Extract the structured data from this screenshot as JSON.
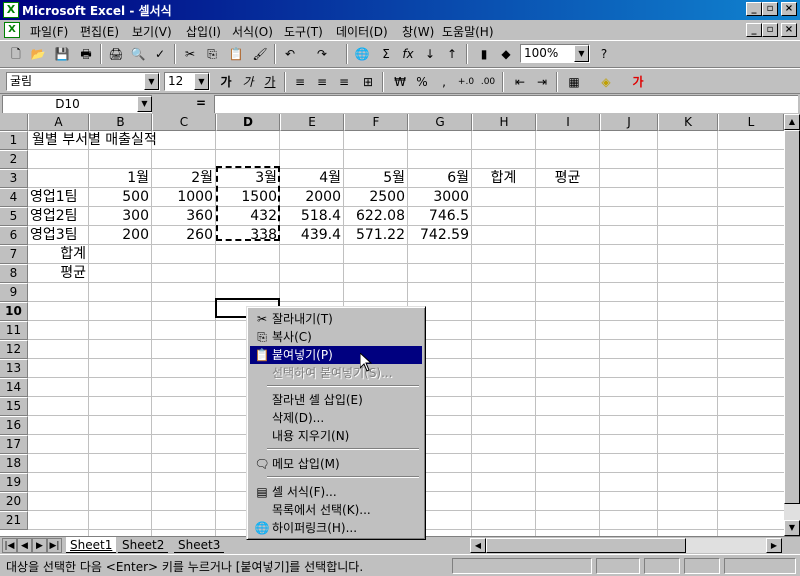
{
  "window": {
    "title": "Microsoft Excel - 셀서식"
  },
  "menu": [
    "파일(F)",
    "편집(E)",
    "보기(V)",
    "삽입(I)",
    "서식(O)",
    "도구(T)",
    "데이터(D)",
    "창(W)",
    "도움말(H)"
  ],
  "toolbar": {
    "zoom": "100%"
  },
  "format_toolbar": {
    "font_name": "굴림",
    "font_size": "12"
  },
  "namebox": {
    "value": "D10"
  },
  "formula": {
    "equals": "=",
    "value": ""
  },
  "columns": [
    "A",
    "B",
    "C",
    "D",
    "E",
    "F",
    "G",
    "H",
    "I",
    "J",
    "K",
    "L"
  ],
  "rows": [
    "1",
    "2",
    "3",
    "4",
    "5",
    "6",
    "7",
    "8",
    "9",
    "10",
    "11",
    "12",
    "13",
    "14",
    "15",
    "16",
    "17",
    "18",
    "19",
    "20",
    "21"
  ],
  "cells": {
    "title": "월별 부서별 매출실적",
    "months": [
      "1월",
      "2월",
      "3월",
      "4월",
      "5월",
      "6월",
      "합계",
      "평균"
    ],
    "teams": [
      {
        "name": "영업1팀",
        "values": [
          "500",
          "1000",
          "1500",
          "2000",
          "2500",
          "3000"
        ]
      },
      {
        "name": "영업2팀",
        "values": [
          "300",
          "360",
          "432",
          "518.4",
          "622.08",
          "746.5"
        ]
      },
      {
        "name": "영업3팀",
        "values": [
          "200",
          "260",
          "338",
          "439.4",
          "571.22",
          "742.59"
        ]
      }
    ],
    "sum_label": "합계",
    "avg_label": "평균"
  },
  "sheets": [
    "Sheet1",
    "Sheet2",
    "Sheet3"
  ],
  "status": {
    "message": "대상을 선택한 다음 <Enter> 키를 누르거나 [붙여넣기]를 선택합니다."
  },
  "context_menu": [
    {
      "label": "잘라내기(T)",
      "icon": "scissors-icon"
    },
    {
      "label": "복사(C)",
      "icon": "copy-icon"
    },
    {
      "label": "붙여넣기(P)",
      "icon": "paste-icon",
      "selected": true
    },
    {
      "label": "선택하여 붙여넣기(S)...",
      "disabled": true
    },
    {
      "label": "잘라낸 셀 삽입(E)"
    },
    {
      "label": "삭제(D)..."
    },
    {
      "label": "내용 지우기(N)"
    },
    {
      "label": "메모 삽입(M)",
      "icon": "comment-icon"
    },
    {
      "label": "셀 서식(F)...",
      "icon": "format-cells-icon"
    },
    {
      "label": "목록에서 선택(K)..."
    },
    {
      "label": "하이퍼링크(H)...",
      "icon": "hyperlink-icon"
    }
  ]
}
